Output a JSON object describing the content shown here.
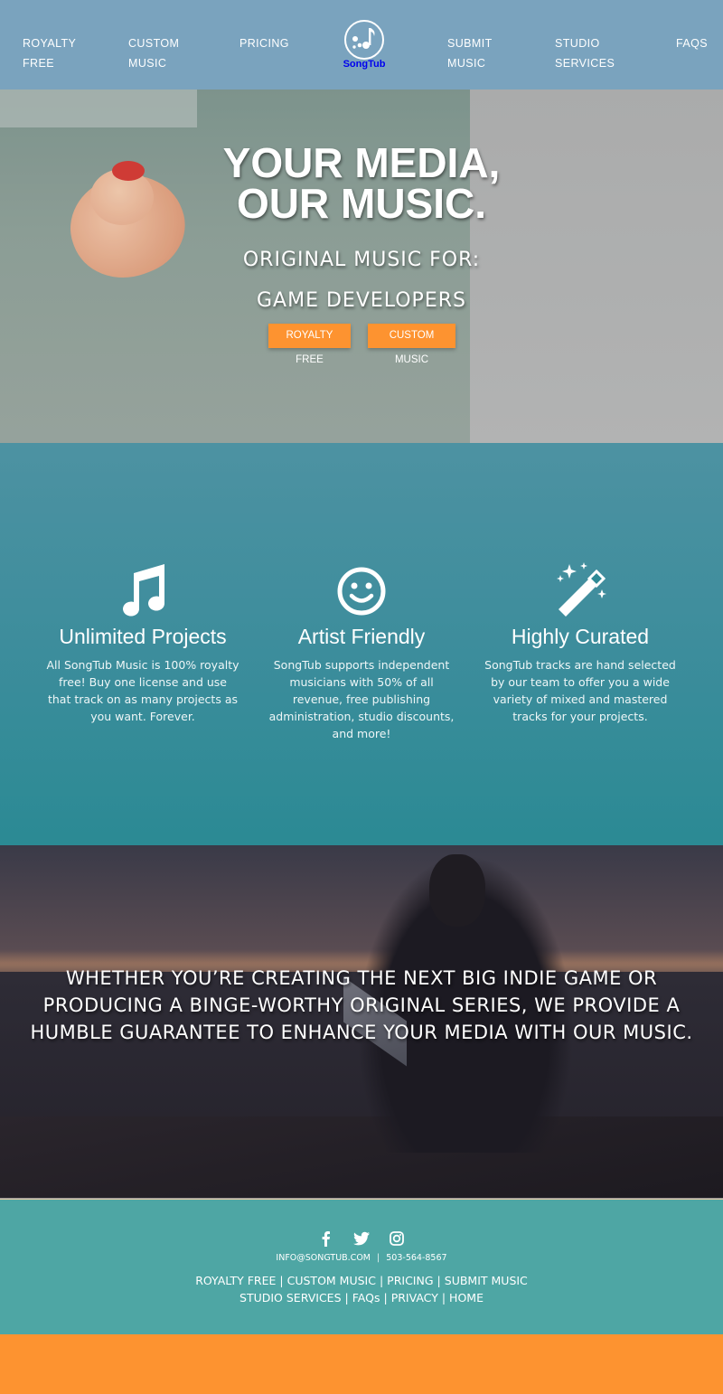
{
  "nav": {
    "left": [
      {
        "label": "ROYALTY\nFREE"
      },
      {
        "label": "CUSTOM\nMUSIC"
      },
      {
        "label": "PRICING"
      }
    ],
    "logo_text": "SongTub",
    "right": [
      {
        "label": "SUBMIT\nMUSIC"
      },
      {
        "label": "STUDIO\nSERVICES"
      },
      {
        "label": "FAQs"
      }
    ]
  },
  "hero": {
    "title": "YOUR MEDIA,\nOUR MUSIC.",
    "subtitle": "ORIGINAL MUSIC FOR:",
    "audience": "GAME DEVELOPERS",
    "buttons": {
      "royalty_free": "ROYALTY FREE",
      "custom_music": "CUSTOM MUSIC"
    }
  },
  "features": [
    {
      "icon": "music-note-icon",
      "title": "Unlimited Projects",
      "text": "All SongTub Music is 100% royalty free! Buy one license and use that track on as many projects as you want. Forever."
    },
    {
      "icon": "smiley-icon",
      "title": "Artist Friendly",
      "text": "SongTub supports independent musicians with 50% of all revenue, free publishing administration, studio discounts, and more!"
    },
    {
      "icon": "magic-wand-icon",
      "title": "Highly Curated",
      "text": "SongTub tracks are hand selected by our team to offer you a wide variety of mixed and mastered tracks for your projects."
    }
  ],
  "quote": "Whether you’re creating the next big indie game or producing a binge-worthy original series, we provide a humble guarantee to enhance your media with our music.",
  "footer": {
    "social": [
      "facebook-icon",
      "twitter-icon",
      "instagram-icon"
    ],
    "email": "INFO@SONGTUB.COM",
    "phone": "503-564-8567",
    "links_row1": [
      "ROYALTY FREE",
      "CUSTOM MUSIC",
      "PRICING",
      "SUBMIT MUSIC"
    ],
    "links_row2": [
      "STUDIO SERVICES",
      "FAQs",
      "PRIVACY",
      "HOME"
    ],
    "separator": "|"
  },
  "colors": {
    "nav_bg": "#7aa3be",
    "accent_orange": "#fd9330",
    "features_bg": "#3d8d9c",
    "footer_bg": "#4ea6a4"
  }
}
